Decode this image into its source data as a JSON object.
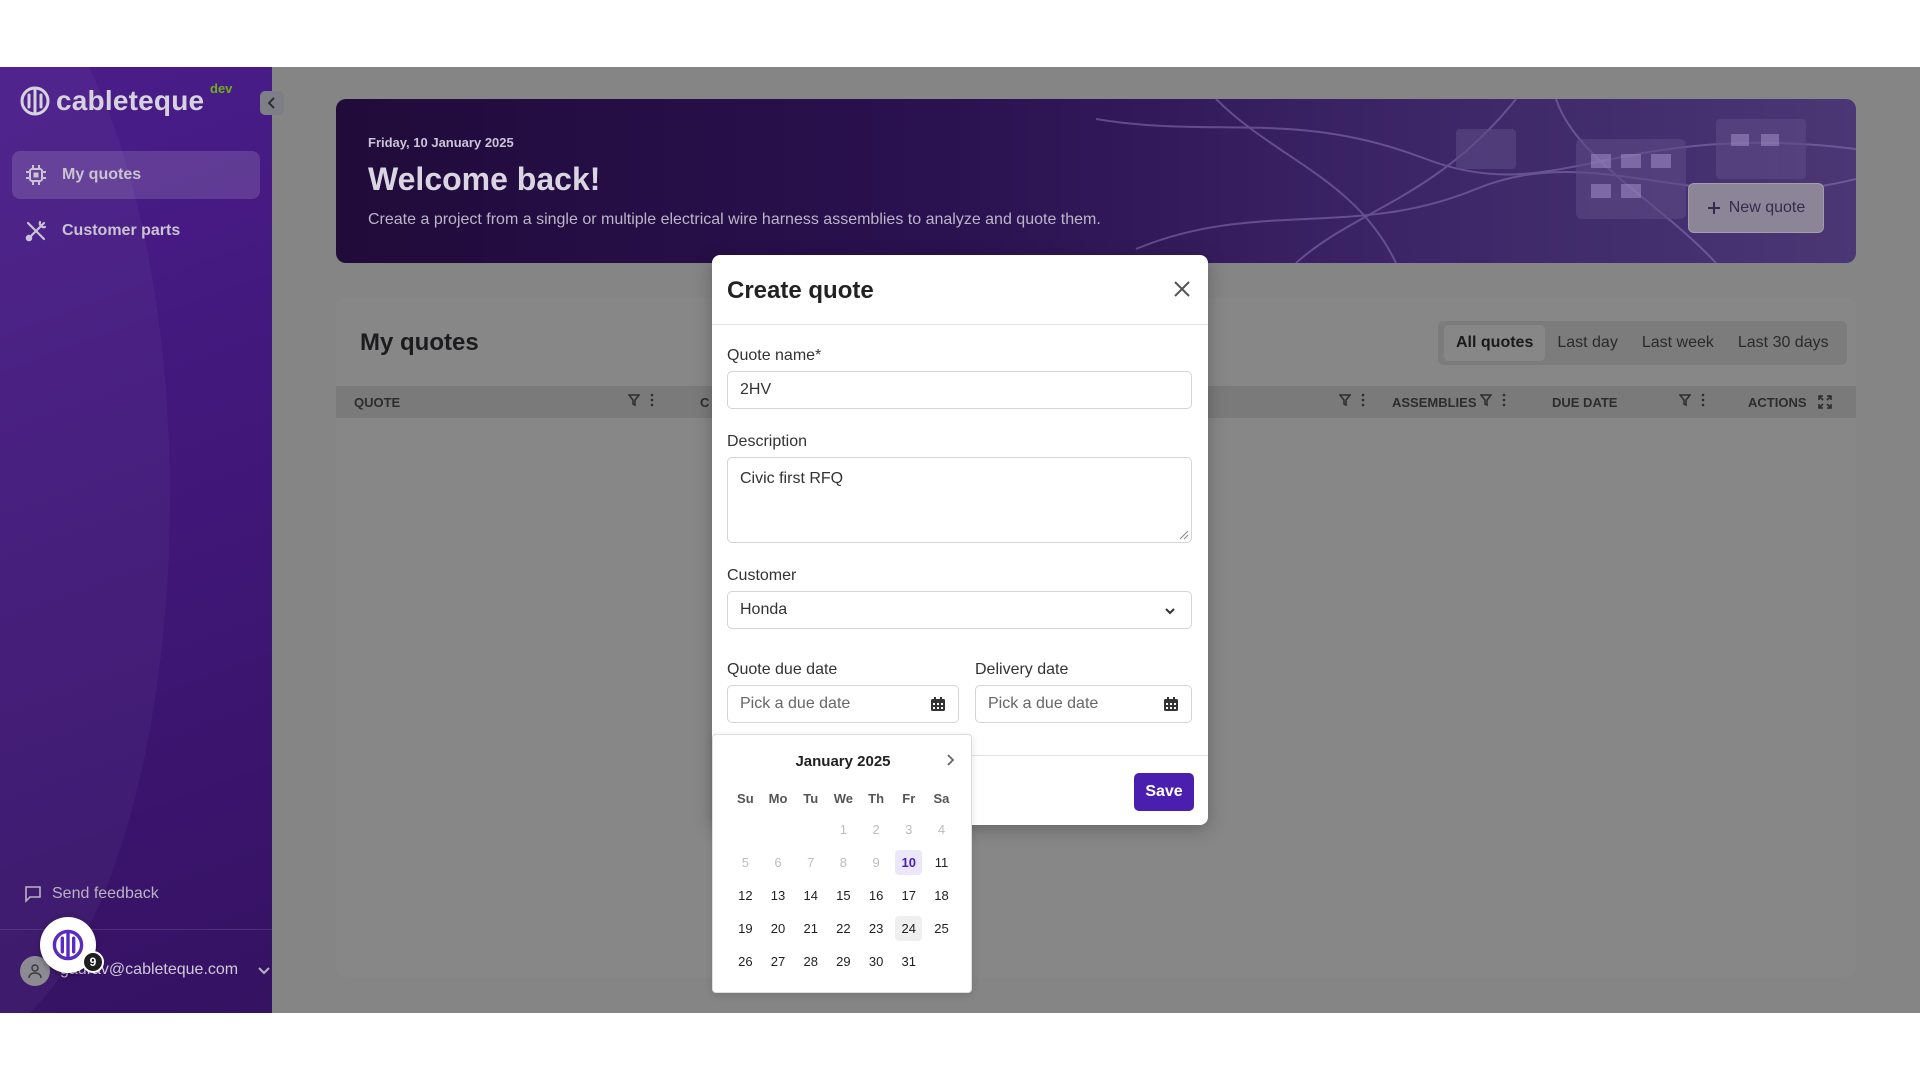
{
  "sidebar": {
    "brand": "cableteque",
    "env_tag": "dev",
    "nav": [
      {
        "label": "My quotes",
        "icon": "chip-icon",
        "active": true
      },
      {
        "label": "Customer parts",
        "icon": "tools-icon",
        "active": false
      }
    ],
    "feedback_label": "Send feedback",
    "user_email": "gaurav@cableteque.com",
    "fab_badge": "9"
  },
  "hero": {
    "date": "Friday, 10 January 2025",
    "title": "Welcome back!",
    "subtitle": "Create a project from a single or multiple electrical wire harness assemblies to analyze and quote them.",
    "new_quote_label": "New quote"
  },
  "quotes": {
    "title": "My quotes",
    "filters": [
      "All quotes",
      "Last day",
      "Last week",
      "Last 30 days"
    ],
    "active_filter": "All quotes",
    "columns": [
      "QUOTE",
      "C",
      "ASSEMBLIES",
      "DUE DATE",
      "ACTIONS"
    ]
  },
  "modal": {
    "title": "Create quote",
    "quote_name_label": "Quote name*",
    "quote_name_value": "2HV",
    "description_label": "Description",
    "description_value": "Civic first RFQ",
    "customer_label": "Customer",
    "customer_value": "Honda",
    "quote_due_label": "Quote due date",
    "quote_due_placeholder": "Pick a due date",
    "delivery_label": "Delivery date",
    "delivery_placeholder": "Pick a due date",
    "save_label": "Save"
  },
  "calendar": {
    "month_label": "January 2025",
    "weekdays": [
      "Su",
      "Mo",
      "Tu",
      "We",
      "Th",
      "Fr",
      "Sa"
    ],
    "leading_blanks": 3,
    "days_in_month": 31,
    "disabled_before": 10,
    "today": 10,
    "highlighted": 24
  },
  "colors": {
    "primary": "#4a1fb0",
    "sidebar": "#3f1676",
    "env_tag": "#6fb01c"
  }
}
